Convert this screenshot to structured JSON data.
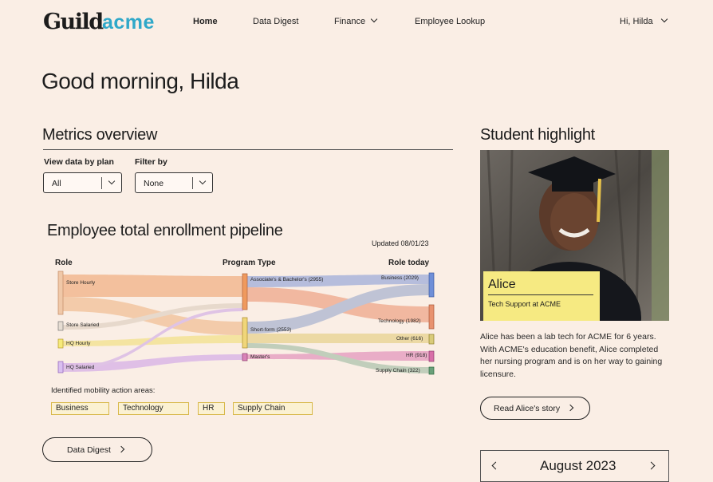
{
  "brand": {
    "guild": "Guild",
    "acme": "acme"
  },
  "nav": {
    "home": "Home",
    "data_digest": "Data Digest",
    "finance": "Finance",
    "employee_lookup": "Employee Lookup",
    "user_greeting": "Hi, Hilda"
  },
  "greeting": "Good morning, Hilda",
  "metrics": {
    "title": "Metrics overview",
    "plan_label": "View data by plan",
    "plan_value": "All",
    "filter_label": "Filter by",
    "filter_value": "None"
  },
  "pipeline": {
    "title": "Employee total enrollment pipeline",
    "updated": "Updated 08/01/23",
    "col_role": "Role",
    "col_program": "Program Type",
    "col_role_today": "Role today",
    "roles": [
      "Store Hourly",
      "Store Salaried",
      "HQ Hourly",
      "HQ Salaried"
    ],
    "programs": [
      "Associate's & Bachelor's (2955)",
      "Short-form (2553)",
      "Master's"
    ],
    "roles_today": [
      "Business (2029)",
      "Technology (1982)",
      "Other (616)",
      "HR (918)",
      "Supply Chain (322)"
    ],
    "colors": {
      "store_hourly": "#ecb07f",
      "store_salaried": "#d8cfc4",
      "hq_hourly": "#f2e26a",
      "hq_salaried": "#c9a0e6",
      "business": "#6f8fd8",
      "technology": "#e8926f",
      "other": "#d9cb7a",
      "hr": "#d86fa8",
      "supply_chain": "#6aa07a"
    }
  },
  "mobility": {
    "label": "Identified mobility action areas:",
    "chips": [
      "Business",
      "Technology",
      "HR",
      "Supply Chain"
    ]
  },
  "data_digest_button": "Data Digest",
  "highlight": {
    "title": "Student highlight",
    "name": "Alice",
    "role": "Tech Support  at ACME",
    "story": "Alice has been a lab tech for ACME for 6 years. With ACME's education benefit, Alice completed her nursing program and is on her way to gaining licensure.",
    "button": "Read Alice's story"
  },
  "calendar": {
    "month": "August 2023"
  }
}
